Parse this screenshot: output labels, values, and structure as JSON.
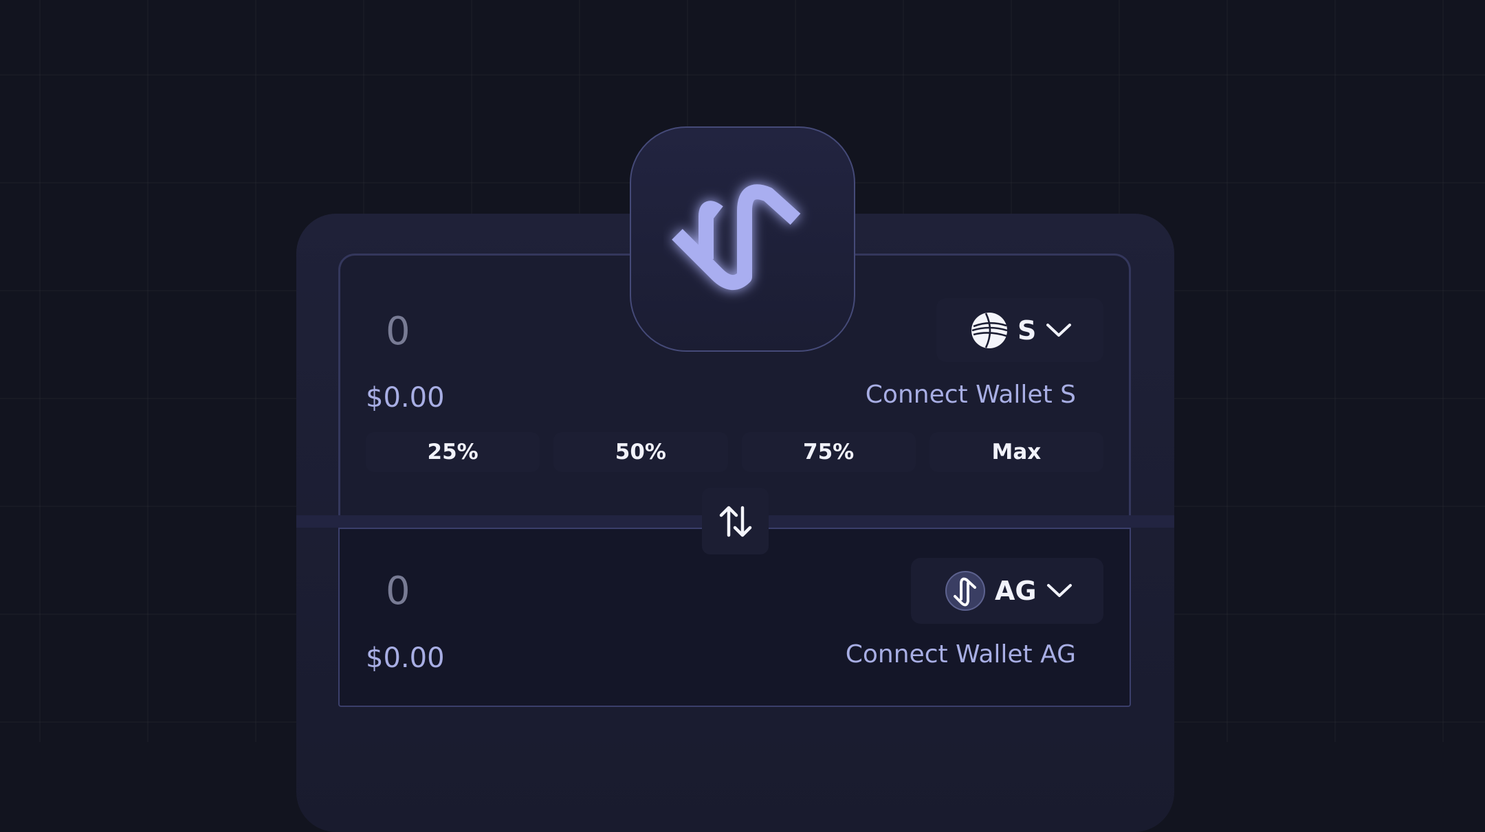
{
  "swap": {
    "from": {
      "amount": "0",
      "usd_value": "$0.00",
      "token_symbol": "S",
      "connect_label": "Connect Wallet S"
    },
    "to": {
      "amount": "0",
      "usd_value": "$0.00",
      "token_symbol": "AG",
      "connect_label": "Connect Wallet AG"
    },
    "percent_buttons": [
      "25%",
      "50%",
      "75%",
      "Max"
    ]
  },
  "icons": {
    "logo": "app-logo-icon",
    "swap": "swap-arrows-icon",
    "chevron": "chevron-down-icon",
    "token_s": "sonic-token-icon",
    "token_ag": "ag-token-icon"
  },
  "colors": {
    "background": "#12141f",
    "card": "#1c1e33",
    "accent": "#a8aee4",
    "text": "#f1f2fa",
    "muted": "#787b94"
  }
}
